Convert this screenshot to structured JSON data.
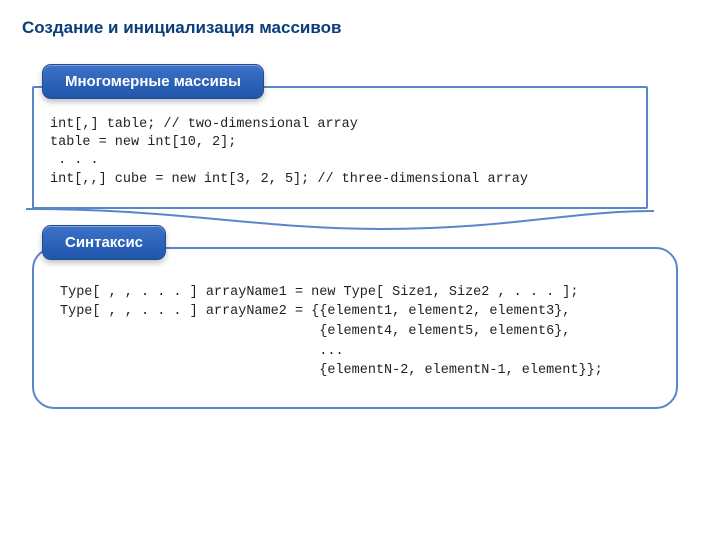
{
  "title": "Создание и инициализация массивов",
  "section1": {
    "heading": "Многомерные массивы",
    "code": "int[,] table; // two-dimensional array\ntable = new int[10, 2];\n . . .\nint[,,] cube = new int[3, 2, 5]; // three-dimensional array"
  },
  "section2": {
    "heading": "Синтаксис",
    "code": "Type[ , , . . . ] arrayName1 = new Type[ Size1, Size2 , . . . ];\nType[ , , . . . ] arrayName2 = {{element1, element2, element3},\n                                {element4, element5, element6},\n                                ...\n                                {elementN-2, elementN-1, element}};"
  }
}
